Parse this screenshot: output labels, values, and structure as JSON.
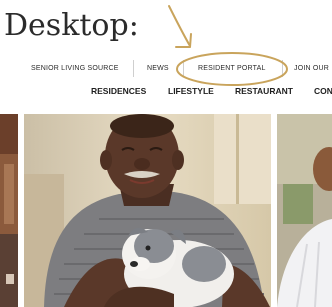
{
  "heading": "Desktop:",
  "utility_nav": {
    "items": [
      "SENIOR LIVING SOURCE",
      "NEWS",
      "RESIDENT PORTAL",
      "JOIN OUR"
    ]
  },
  "main_nav": {
    "items": [
      "RESIDENCES",
      "LIFESTYLE",
      "RESTAURANT",
      "CON"
    ]
  },
  "colors": {
    "annotation": "#c9a45c",
    "text": "#2b2b2b"
  }
}
